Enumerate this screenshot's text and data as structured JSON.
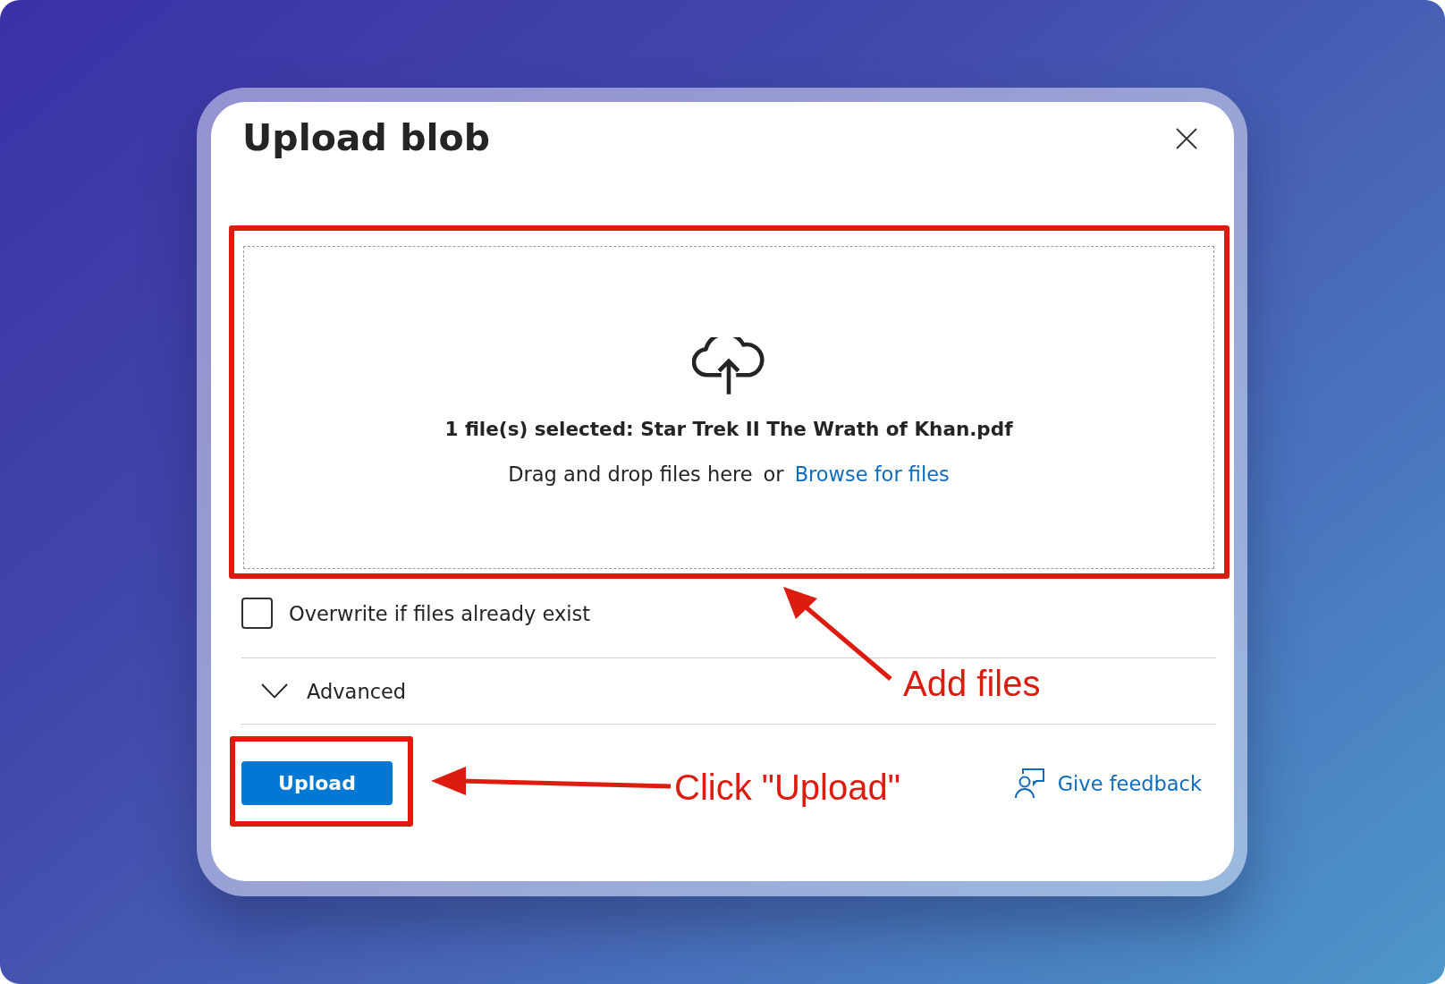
{
  "dialog": {
    "title": "Upload blob"
  },
  "dropzone": {
    "selected_text": "1 file(s) selected: Star Trek II The Wrath of Khan.pdf",
    "hint": "Drag and drop files here",
    "separator": "or",
    "link": "Browse for files",
    "callout": "Add files"
  },
  "overwrite": {
    "label": "Overwrite if files already exist",
    "checked": false
  },
  "advanced": {
    "label": "Advanced",
    "expanded": false
  },
  "footer": {
    "upload_button": "Upload",
    "feedback_link": "Give feedback",
    "callout": "Click \"Upload\""
  }
}
